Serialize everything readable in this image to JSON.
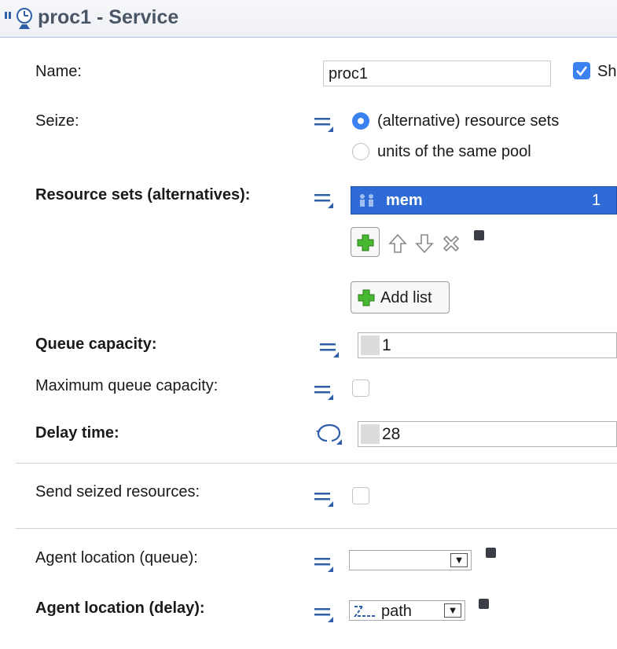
{
  "header": {
    "title": "proc1 - Service",
    "icon": "service-block-icon"
  },
  "fields": {
    "name": {
      "label": "Name:",
      "value": "proc1",
      "show_label": "Sh",
      "show_checked": true
    },
    "seize": {
      "label": "Seize:",
      "options": [
        "(alternative) resource sets",
        "units of the same pool"
      ],
      "selected": "(alternative) resource sets"
    },
    "resource_sets": {
      "label": "Resource sets (alternatives):",
      "rows": [
        {
          "name": "mem",
          "count": "1"
        }
      ],
      "add_list_label": "Add list"
    },
    "queue_capacity": {
      "label": "Queue capacity:",
      "value": "1"
    },
    "max_queue_capacity": {
      "label": "Maximum queue capacity:",
      "checked": false
    },
    "delay_time": {
      "label": "Delay time:",
      "value": "28"
    },
    "send_seized": {
      "label": "Send seized resources:",
      "checked": false
    },
    "agent_location_queue": {
      "label": "Agent location (queue):",
      "value": ""
    },
    "agent_location_delay": {
      "label": "Agent location (delay):",
      "value": "path"
    }
  },
  "colors": {
    "selection": "#2f6bd6",
    "accent": "#3b82f0",
    "icon_blue": "#2f5fa8"
  }
}
